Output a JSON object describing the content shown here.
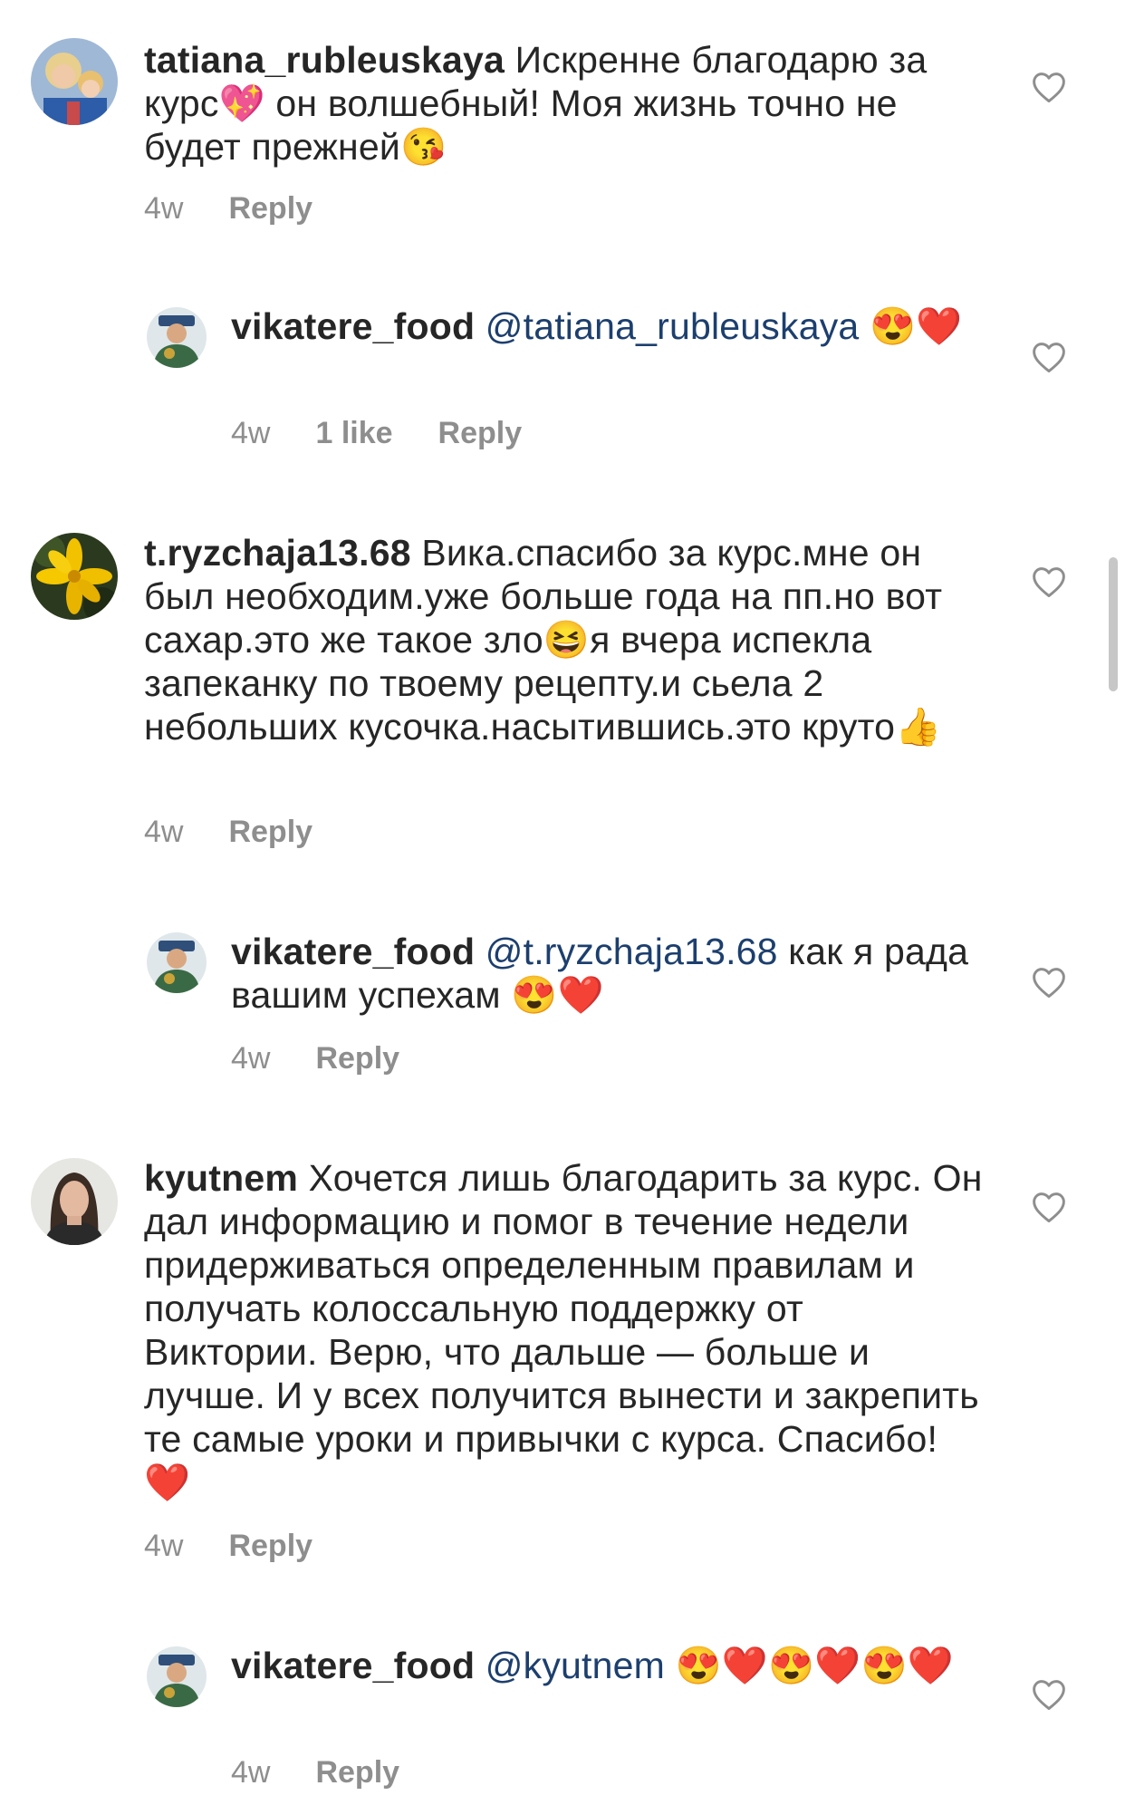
{
  "comments": [
    {
      "username": "tatiana_rubleuskaya",
      "text": "Искренне благодарю за курс💖 он волшебный! Моя жизнь точно не будет прежней😘",
      "time": "4w",
      "reply": "Reply"
    },
    {
      "username": "vikatere_food",
      "mention": "@tatiana_rubleuskaya",
      "text": " 😍❤️",
      "time": "4w",
      "likes": "1 like",
      "reply": "Reply"
    },
    {
      "username": "t.ryzchaja13.68",
      "text": "Вика.спасибо за курс.мне он был необходим.уже больше года на пп.но вот сахар.это же такое зло😆я вчера испекла запеканку по твоему рецепту.и сьела 2 небольших кусочка.насытившись.это круто👍",
      "time": "4w",
      "reply": "Reply"
    },
    {
      "username": "vikatere_food",
      "mention": "@t.ryzchaja13.68",
      "text": " как я рада вашим успехам 😍❤️",
      "time": "4w",
      "reply": "Reply"
    },
    {
      "username": "kyutnem",
      "text": "Хочется лишь благодарить за курс. Он дал информацию и помог в течение недели придерживаться определенным правилам и получать колоссальную поддержку от Виктории. Верю, что дальше — больше и лучше. И у всех получится вынести и закрепить те самые уроки и привычки с курса. Спасибо! ❤️",
      "time": "4w",
      "reply": "Reply"
    },
    {
      "username": "vikatere_food",
      "mention": "@kyutnem",
      "text": " 😍❤️😍❤️😍❤️",
      "time": "4w",
      "reply": "Reply"
    }
  ],
  "colors": {
    "text": "#262626",
    "mention": "#1c3f6e",
    "meta": "#8e8e8e",
    "heart_outline": "#8e8e8e"
  },
  "icons": {
    "like": "heart-outline-icon"
  }
}
